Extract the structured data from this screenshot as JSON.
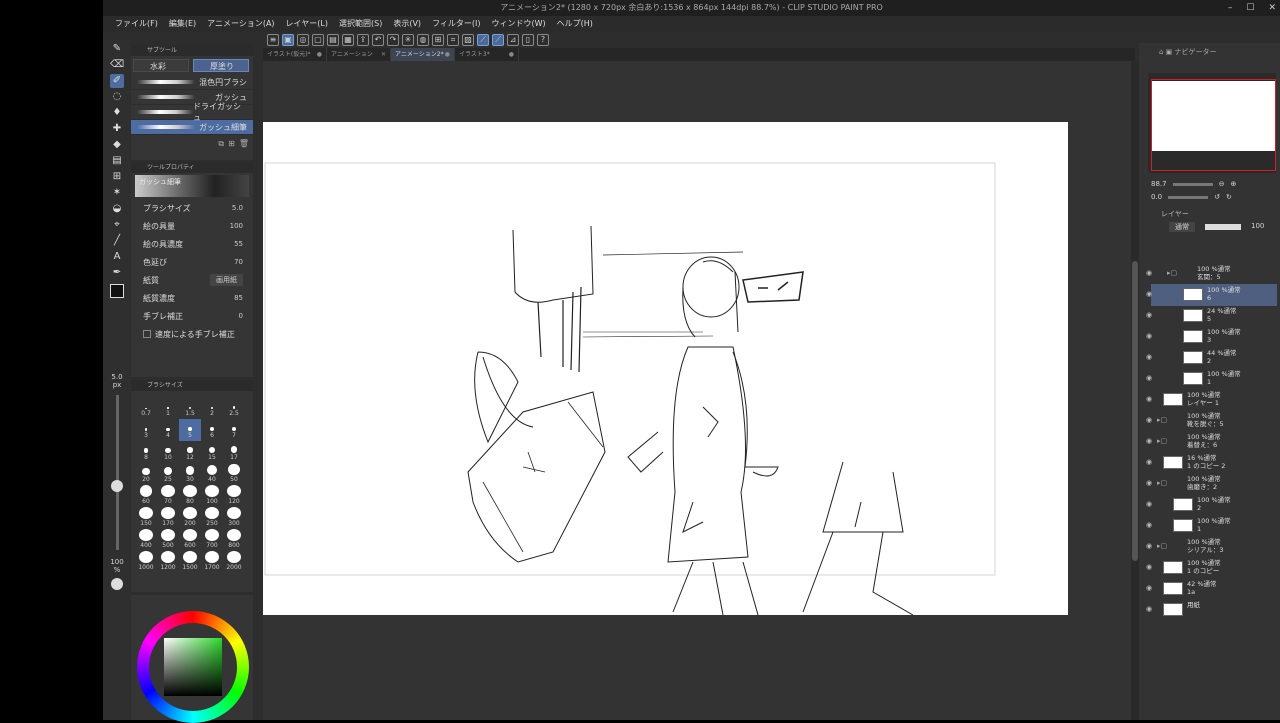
{
  "window": {
    "title": "アニメーション2* (1280 x 720px 余白あり:1536 x 864px 144dpi 88.7%) - CLIP STUDIO PAINT PRO",
    "minimize": "–",
    "maximize": "☐",
    "close": "✕"
  },
  "menu": [
    "ファイル(F)",
    "編集(E)",
    "アニメーション(A)",
    "レイヤー(L)",
    "選択範囲(S)",
    "表示(V)",
    "フィルター(I)",
    "ウィンドウ(W)",
    "ヘルプ(H)"
  ],
  "tabs": [
    {
      "label": "イラスト(仮元)*",
      "active": false
    },
    {
      "label": "アニメーション",
      "active": false
    },
    {
      "label": "アニメーション2*",
      "active": true
    },
    {
      "label": "イラスト3*",
      "active": false
    }
  ],
  "subtool": {
    "header": "サブツール",
    "tab1": "水彩",
    "tab2": "厚塗り",
    "brushes": [
      "混色円ブラシ",
      "ガッシュ",
      "ドライガッシュ",
      "ガッシュ細筆"
    ],
    "selected": 3
  },
  "toolprop": {
    "header": "ツールプロパティ",
    "brush_name": "ガッシュ細筆",
    "rows": [
      {
        "label": "ブラシサイズ",
        "value": "5.0"
      },
      {
        "label": "絵の具量",
        "value": "100"
      },
      {
        "label": "絵の具濃度",
        "value": "55"
      },
      {
        "label": "色延び",
        "value": "70"
      },
      {
        "label": "紙質",
        "value": "画用紙"
      },
      {
        "label": "紙質濃度",
        "value": "85"
      },
      {
        "label": "手ブレ補正",
        "value": "0"
      }
    ],
    "checkbox": "速度による手ブレ補正"
  },
  "size_indicator": {
    "size": "5.0",
    "unit": "px",
    "opacity": "100",
    "opacity_unit": "%"
  },
  "brushsize": {
    "header": "ブラシサイズ",
    "values": [
      "0.7",
      "1",
      "1.5",
      "2",
      "2.5",
      "3",
      "4",
      "5",
      "6",
      "7",
      "8",
      "10",
      "12",
      "15",
      "17",
      "20",
      "25",
      "30",
      "40",
      "50",
      "60",
      "70",
      "80",
      "100",
      "120",
      "150",
      "170",
      "200",
      "250",
      "300",
      "400",
      "500",
      "600",
      "700",
      "800",
      "1000",
      "1200",
      "1500",
      "1700",
      "2000"
    ],
    "selected": "5"
  },
  "navigator": {
    "zoom": "88.7",
    "rotate": "0.0",
    "tab": "ナビゲーター"
  },
  "layers": {
    "header": "レイヤー",
    "blend": "通常",
    "opacity": "100",
    "items": [
      {
        "pct": "100 %通常",
        "name": "玄関：5",
        "indent": 1,
        "folder": true
      },
      {
        "pct": "100 %通常",
        "name": "6",
        "indent": 2,
        "selected": true
      },
      {
        "pct": "24 %通常",
        "name": "5",
        "indent": 2
      },
      {
        "pct": "100 %通常",
        "name": "3",
        "indent": 2
      },
      {
        "pct": "44 %通常",
        "name": "2",
        "indent": 2
      },
      {
        "pct": "100 %通常",
        "name": "1",
        "indent": 2
      },
      {
        "pct": "100 %通常",
        "name": "レイヤー 1",
        "indent": 0
      },
      {
        "pct": "100 %通常",
        "name": "靴を脱ぐ：5",
        "indent": 0,
        "folder": true
      },
      {
        "pct": "100 %通常",
        "name": "着替え：6",
        "indent": 0,
        "folder": true
      },
      {
        "pct": "16 %通常",
        "name": "1 のコピー 2",
        "indent": 0
      },
      {
        "pct": "100 %通常",
        "name": "歯磨き：2",
        "indent": 0,
        "folder": true
      },
      {
        "pct": "100 %通常",
        "name": "2",
        "indent": 1
      },
      {
        "pct": "100 %通常",
        "name": "1",
        "indent": 1
      },
      {
        "pct": "100 %通常",
        "name": "シリアル：3",
        "indent": 0,
        "folder": true
      },
      {
        "pct": "100 %通常",
        "name": "1 のコピー",
        "indent": 0
      },
      {
        "pct": "42 %通常",
        "name": "1a",
        "indent": 0
      },
      {
        "pct": "",
        "name": "用紙",
        "indent": 0
      }
    ]
  },
  "colors": {
    "accent": "#4d6da2",
    "bg": "#2d2d2d",
    "panel": "#353535",
    "red_frame": "#d02020"
  }
}
